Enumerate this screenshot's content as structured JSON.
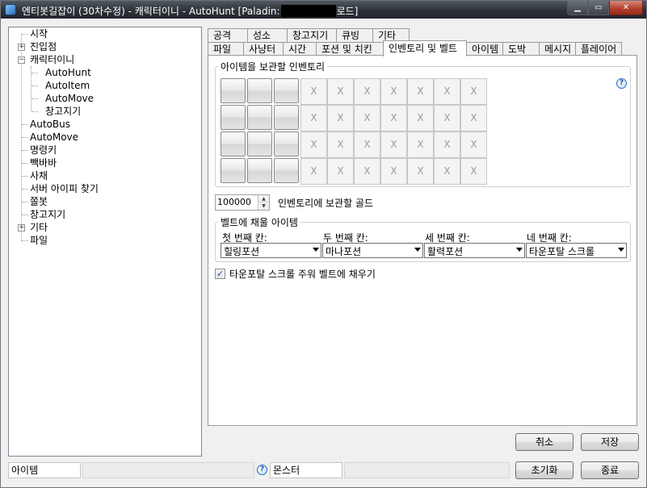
{
  "window": {
    "title_prefix": "엔티봇길잡이 (30차수정) - 캐릭터이니 - AutoHunt [Paladin:",
    "title_suffix": "로드]",
    "min_glyph": "▁",
    "max_glyph": "▭",
    "close_glyph": "✕"
  },
  "tree": {
    "items": [
      {
        "label": "시작"
      },
      {
        "label": "진입점",
        "expander": "+"
      },
      {
        "label": "캐릭터이니",
        "expander": "−"
      },
      {
        "label": "AutoHunt"
      },
      {
        "label": "AutoItem"
      },
      {
        "label": "AutoMove"
      },
      {
        "label": "창고지기"
      },
      {
        "label": "AutoBus"
      },
      {
        "label": "AutoMove"
      },
      {
        "label": "명령키"
      },
      {
        "label": "빽바바"
      },
      {
        "label": "사채"
      },
      {
        "label": "서버 아이피 찾기"
      },
      {
        "label": "쫄봇"
      },
      {
        "label": "창고지기"
      },
      {
        "label": "기타",
        "expander": "+"
      },
      {
        "label": "파일"
      }
    ]
  },
  "tabs": {
    "row1": [
      "공격",
      "성소",
      "창고지기",
      "큐빙",
      "기타"
    ],
    "row2": [
      "파일",
      "사냥터",
      "시간",
      "포션 및 치킨",
      "인벤토리 및 벨트",
      "아이템",
      "도박",
      "메시지",
      "플레이어"
    ],
    "active": "인벤토리 및 벨트"
  },
  "inventory": {
    "group_label": "아이템을 보관할 인벤토리",
    "x_mark": "X",
    "help_glyph": "?"
  },
  "gold": {
    "value": "100000",
    "label": "인벤토리에 보관할 골드"
  },
  "belt": {
    "group_label": "벨트에 채울 아이템",
    "slots": [
      {
        "label": "첫 번째 칸:",
        "value": "힐링포션"
      },
      {
        "label": "두 번째 칸:",
        "value": "마나포션"
      },
      {
        "label": "세 번째 칸:",
        "value": "활력포션"
      },
      {
        "label": "네 번째 칸:",
        "value": "타운포탈 스크롤"
      }
    ]
  },
  "townportal": {
    "checked": true,
    "check_glyph": "✓",
    "label": "타운포탈 스크롤 주워 벨트에 채우기"
  },
  "buttons": {
    "cancel": "취소",
    "save": "저장",
    "reset": "초기화",
    "exit": "종료"
  },
  "status": {
    "item_label": "아이템",
    "help_glyph": "?",
    "monster_label": "몬스터"
  }
}
